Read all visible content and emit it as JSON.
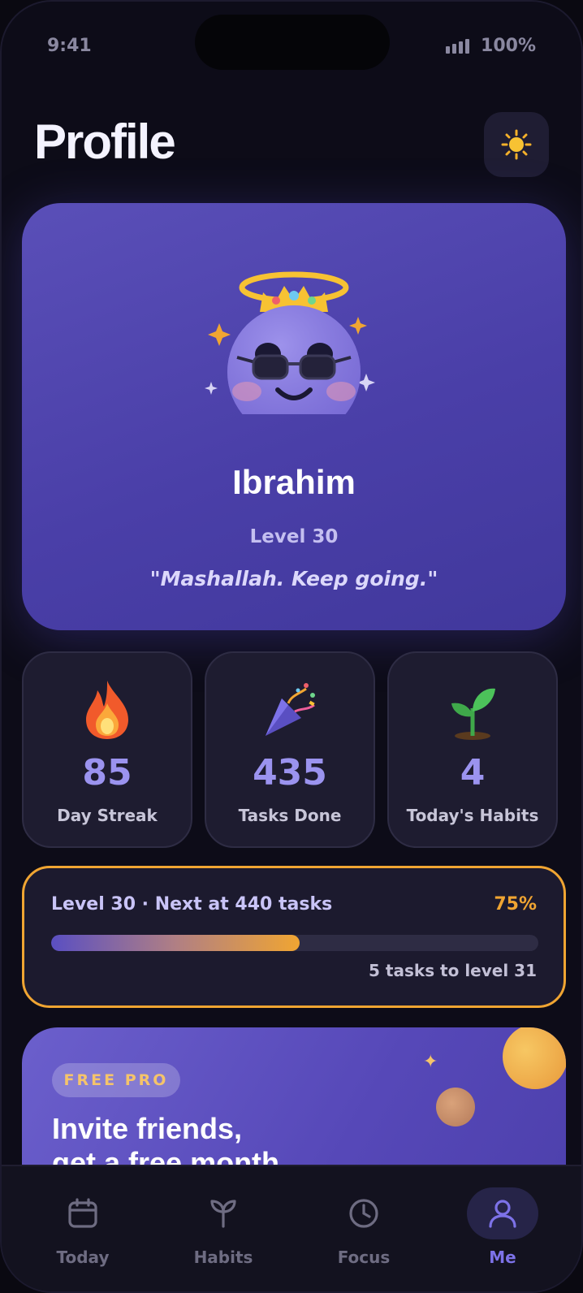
{
  "status_bar": {
    "time": "9:41",
    "battery": "100%"
  },
  "header": {
    "title": "Profile",
    "theme_icon": "sun-icon"
  },
  "profile": {
    "name": "Ibrahim",
    "level": "Level 30",
    "quote": "\"Mashallah. Keep going.\""
  },
  "stats": [
    {
      "icon": "fire-icon",
      "value": "85",
      "label": "Day Streak"
    },
    {
      "icon": "party-popper-icon",
      "value": "435",
      "label": "Tasks Done"
    },
    {
      "icon": "seedling-icon",
      "value": "4",
      "label": "Today's Habits"
    }
  ],
  "level_progress": {
    "text": "Level 30 · Next at 440 tasks",
    "percent_label": "75%",
    "progress": 0.51,
    "remaining": "5 tasks to level 31",
    "colors": {
      "border": "#f0a532",
      "start": "#5a4fc2",
      "end": "#f0a532"
    }
  },
  "invite": {
    "badge": "FREE PRO",
    "title_line1": "Invite friends,",
    "title_line2": "get a free month."
  },
  "nav": [
    {
      "label": "Today",
      "icon": "calendar-icon",
      "active": false
    },
    {
      "label": "Habits",
      "icon": "sprout-icon",
      "active": false
    },
    {
      "label": "Focus",
      "icon": "clock-icon",
      "active": false
    },
    {
      "label": "Me",
      "icon": "user-icon",
      "active": true
    }
  ],
  "colors": {
    "accent": "#7d72e8",
    "card": "#1e1c30",
    "background": "#0d0c18"
  }
}
